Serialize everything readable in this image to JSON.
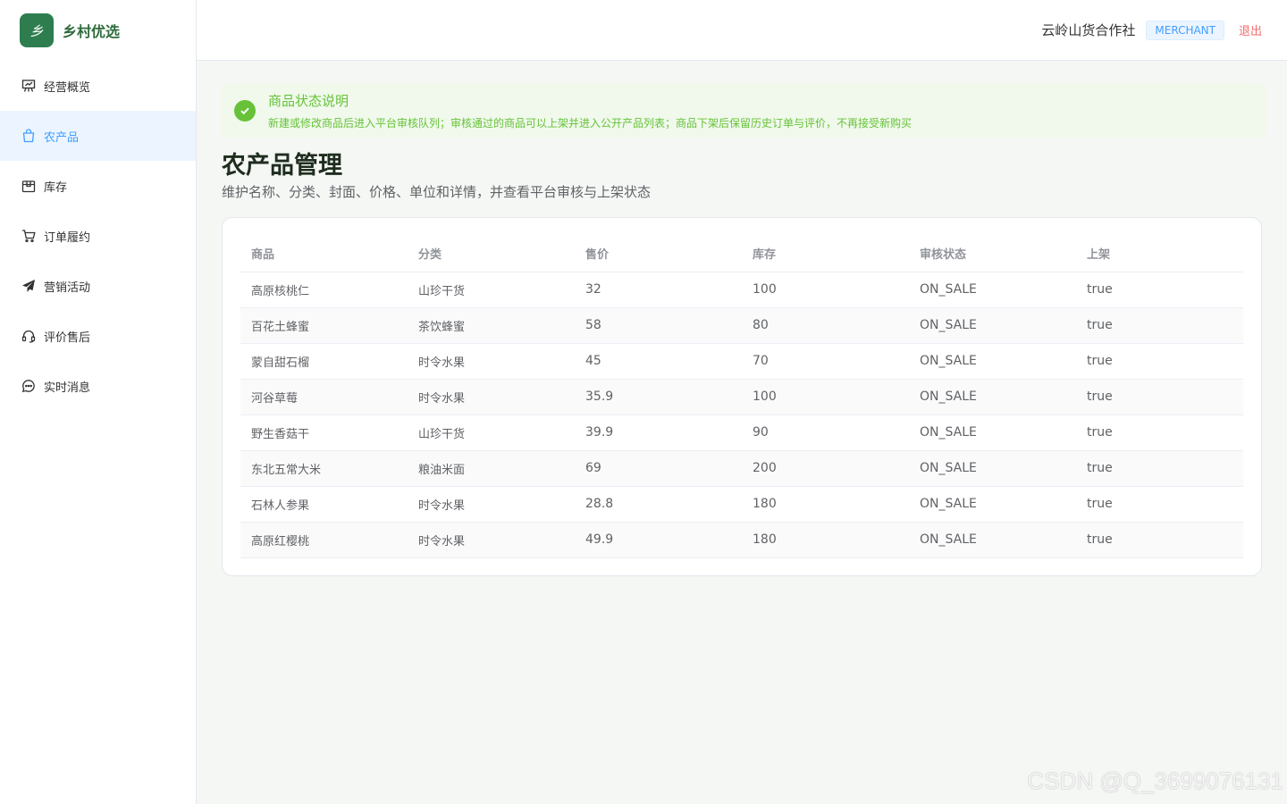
{
  "brand": {
    "logo_text": "乡",
    "name": "乡村优选"
  },
  "sidebar": {
    "items": [
      {
        "label": "经营概览",
        "icon": "chart-board-icon"
      },
      {
        "label": "农产品",
        "icon": "shopping-bag-icon",
        "active": true
      },
      {
        "label": "库存",
        "icon": "box-icon"
      },
      {
        "label": "订单履约",
        "icon": "cart-icon"
      },
      {
        "label": "营销活动",
        "icon": "paper-plane-icon"
      },
      {
        "label": "评价售后",
        "icon": "headset-icon"
      },
      {
        "label": "实时消息",
        "icon": "chat-bubble-icon"
      }
    ]
  },
  "header": {
    "shop_name": "云岭山货合作社",
    "role": "MERCHANT",
    "logout": "退出"
  },
  "alert": {
    "title": "商品状态说明",
    "description": "新建或修改商品后进入平台审核队列；审核通过的商品可以上架并进入公开产品列表；商品下架后保留历史订单与评价，不再接受新购买"
  },
  "page": {
    "title": "农产品管理",
    "subtitle": "维护名称、分类、封面、价格、单位和详情，并查看平台审核与上架状态"
  },
  "table": {
    "headers": [
      "商品",
      "分类",
      "售价",
      "库存",
      "审核状态",
      "上架"
    ],
    "rows": [
      [
        "高原核桃仁",
        "山珍干货",
        "32",
        "100",
        "ON_SALE",
        "true"
      ],
      [
        "百花土蜂蜜",
        "茶饮蜂蜜",
        "58",
        "80",
        "ON_SALE",
        "true"
      ],
      [
        "蒙自甜石榴",
        "时令水果",
        "45",
        "70",
        "ON_SALE",
        "true"
      ],
      [
        "河谷草莓",
        "时令水果",
        "35.9",
        "100",
        "ON_SALE",
        "true"
      ],
      [
        "野生香菇干",
        "山珍干货",
        "39.9",
        "90",
        "ON_SALE",
        "true"
      ],
      [
        "东北五常大米",
        "粮油米面",
        "69",
        "200",
        "ON_SALE",
        "true"
      ],
      [
        "石林人参果",
        "时令水果",
        "28.8",
        "180",
        "ON_SALE",
        "true"
      ],
      [
        "高原红樱桃",
        "时令水果",
        "49.9",
        "180",
        "ON_SALE",
        "true"
      ]
    ]
  },
  "watermark": "CSDN @Q_3699076131",
  "colors": {
    "brand": "#2e7d4f",
    "active": "#409eff",
    "success": "#67c23a",
    "danger": "#f56c6c"
  }
}
